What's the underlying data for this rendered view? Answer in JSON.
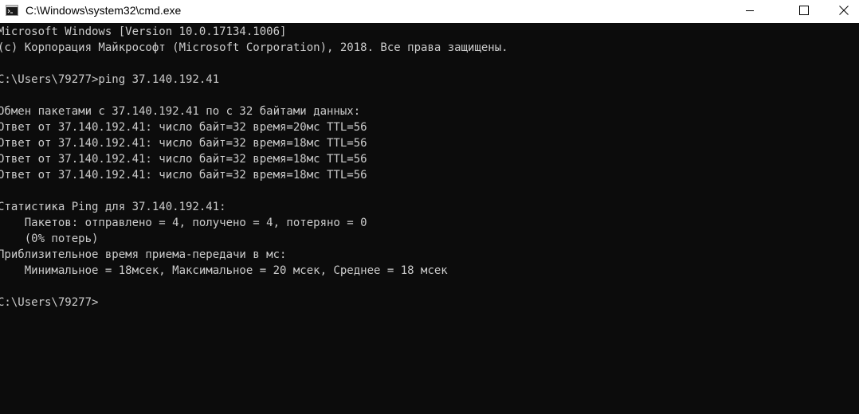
{
  "window": {
    "title": "C:\\Windows\\system32\\cmd.exe",
    "app_icon": "console-icon",
    "controls": {
      "minimize_icon": "minimize-icon",
      "maximize_icon": "maximize-icon",
      "close_icon": "close-icon"
    }
  },
  "console": {
    "lines": [
      "Microsoft Windows [Version 10.0.17134.1006]",
      "(c) Корпорация Майкрософт (Microsoft Corporation), 2018. Все права защищены.",
      "",
      "C:\\Users\\79277>ping 37.140.192.41",
      "",
      "Обмен пакетами с 37.140.192.41 по с 32 байтами данных:",
      "Ответ от 37.140.192.41: число байт=32 время=20мс TTL=56",
      "Ответ от 37.140.192.41: число байт=32 время=18мс TTL=56",
      "Ответ от 37.140.192.41: число байт=32 время=18мс TTL=56",
      "Ответ от 37.140.192.41: число байт=32 время=18мс TTL=56",
      "",
      "Статистика Ping для 37.140.192.41:",
      "    Пакетов: отправлено = 4, получено = 4, потеряно = 0",
      "    (0% потерь)",
      "Приблизительное время приема-передачи в мс:",
      "    Минимальное = 18мсек, Максимальное = 20 мсек, Среднее = 18 мсек",
      "",
      "C:\\Users\\79277>"
    ]
  },
  "colors": {
    "console_background": "#0c0c0c",
    "console_text": "#cccccc",
    "titlebar_background": "#ffffff"
  }
}
